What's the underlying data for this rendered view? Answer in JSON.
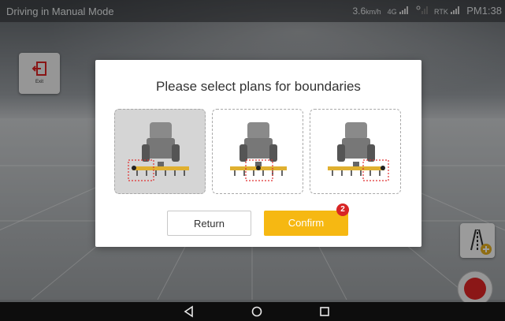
{
  "status_bar": {
    "app_title": "Driving in Manual Mode",
    "speed": "3.6",
    "speed_unit": "km/h",
    "net_label": "4G",
    "rtk_label": "RTK",
    "time": "PM1:38"
  },
  "exit_button": {
    "label": "Exit"
  },
  "dialog": {
    "title": "Please select plans for boundaries",
    "plans": [
      {
        "selected": true
      },
      {
        "selected": false
      },
      {
        "selected": false
      }
    ],
    "return_label": "Return",
    "confirm_label": "Confirm",
    "confirm_badge": "2"
  },
  "colors": {
    "accent": "#f6b812",
    "badge": "#d82525",
    "record": "#e02626"
  }
}
